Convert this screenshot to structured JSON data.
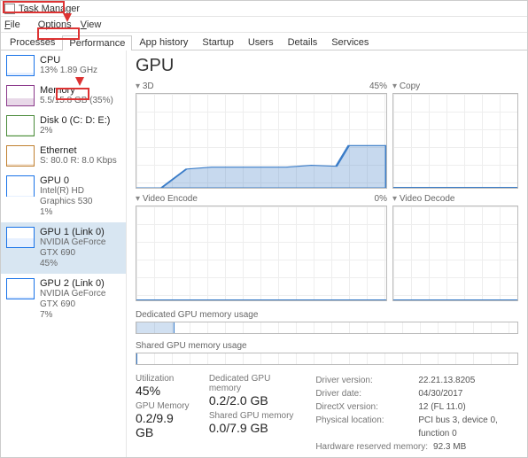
{
  "window": {
    "title": "Task Manager"
  },
  "menu": {
    "file": "File",
    "options": "Options",
    "view": "View"
  },
  "tabs": {
    "items": [
      "Processes",
      "Performance",
      "App history",
      "Startup",
      "Users",
      "Details",
      "Services"
    ],
    "active": 1
  },
  "sidebar": {
    "items": [
      {
        "name": "CPU",
        "sub": "13% 1.89 GHz"
      },
      {
        "name": "Memory",
        "sub": "5.5/15.8 GB (35%)"
      },
      {
        "name": "Disk 0 (C: D: E:)",
        "sub": "2%"
      },
      {
        "name": "Ethernet",
        "sub": "S: 80.0  R: 8.0 Kbps"
      },
      {
        "name": "GPU 0",
        "sub": "Intel(R) HD Graphics 530\n1%"
      },
      {
        "name": "GPU 1 (Link 0)",
        "sub": "NVIDIA GeForce GTX 690\n45%"
      },
      {
        "name": "GPU 2 (Link 0)",
        "sub": "NVIDIA GeForce GTX 690\n7%"
      }
    ],
    "selected": 5
  },
  "main": {
    "title": "GPU",
    "charts": {
      "tl": {
        "label": "3D",
        "right": "45%"
      },
      "tr": {
        "label": "Copy",
        "right": ""
      },
      "bl": {
        "label": "Video Encode",
        "right": "0%"
      },
      "br": {
        "label": "Video Decode",
        "right": ""
      }
    },
    "strip1": {
      "label": "Dedicated GPU memory usage"
    },
    "strip2": {
      "label": "Shared GPU memory usage"
    },
    "stats": {
      "c1": {
        "l1": "Utilization",
        "v1": "45%",
        "l2": "GPU Memory",
        "v2": "0.2/9.9 GB"
      },
      "c2": {
        "l1": "Dedicated GPU memory",
        "v1": "0.2/2.0 GB",
        "l2": "Shared GPU memory",
        "v2": "0.0/7.9 GB"
      },
      "c3": {
        "r1k": "Driver version:",
        "r1v": "22.21.13.8205",
        "r2k": "Driver date:",
        "r2v": "04/30/2017",
        "r3k": "DirectX version:",
        "r3v": "12 (FL 11.0)",
        "r4k": "Physical location:",
        "r4v": "PCI bus 3, device 0, function 0",
        "r5k": "Hardware reserved memory:",
        "r5v": "92.3 MB"
      }
    }
  },
  "chart_data": [
    {
      "type": "area",
      "title": "3D",
      "ylim": [
        0,
        100
      ],
      "x": [
        0,
        10,
        20,
        30,
        40,
        50,
        60,
        70,
        80,
        90,
        100
      ],
      "values": [
        0,
        0,
        20,
        22,
        22,
        22,
        22,
        24,
        23,
        45,
        45
      ]
    },
    {
      "type": "area",
      "title": "Copy",
      "ylim": [
        0,
        100
      ],
      "x": [
        0,
        100
      ],
      "values": [
        0,
        0
      ]
    },
    {
      "type": "area",
      "title": "Video Encode",
      "ylim": [
        0,
        100
      ],
      "x": [
        0,
        100
      ],
      "values": [
        0,
        0
      ]
    },
    {
      "type": "area",
      "title": "Video Decode",
      "ylim": [
        0,
        100
      ],
      "x": [
        0,
        100
      ],
      "values": [
        0,
        0
      ]
    },
    {
      "type": "bar",
      "title": "Dedicated GPU memory usage",
      "categories": [
        "used",
        "total"
      ],
      "values": [
        0.2,
        2.0
      ]
    },
    {
      "type": "bar",
      "title": "Shared GPU memory usage",
      "categories": [
        "used",
        "total"
      ],
      "values": [
        0.0,
        7.9
      ]
    }
  ]
}
